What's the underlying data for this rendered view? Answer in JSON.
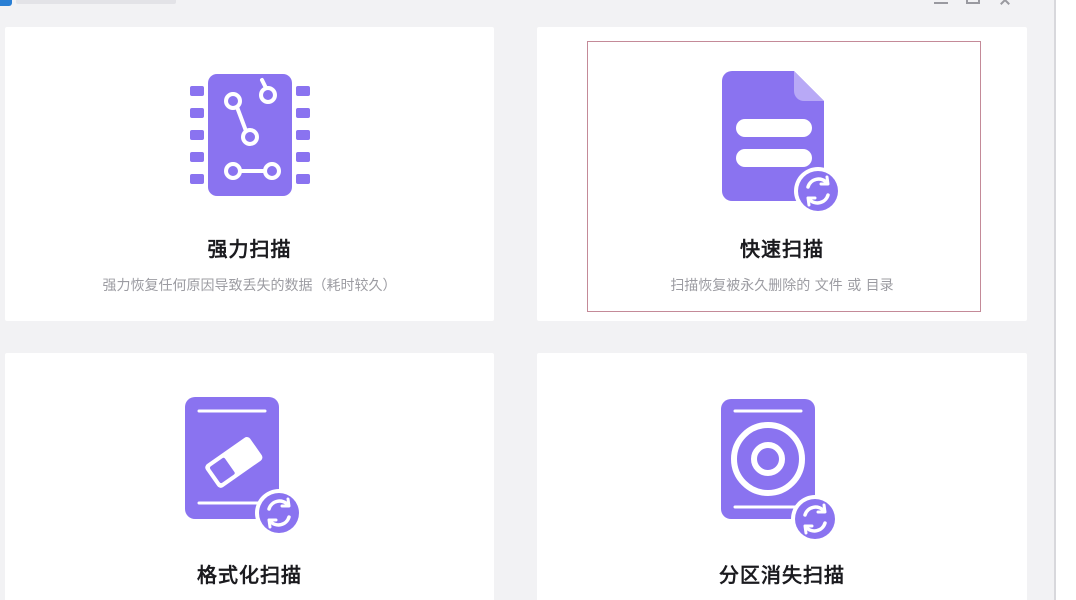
{
  "app": {
    "title": "",
    "accent_color": "#8a73f0",
    "window_controls": [
      "minimize",
      "maximize",
      "close"
    ]
  },
  "scan_modes": [
    {
      "title": "强力扫描",
      "description": "强力恢复任何原因导致丢失的数据（耗时较久）",
      "icon": "chip-icon"
    },
    {
      "title": "快速扫描",
      "description": "扫描恢复被永久删除的 文件 或 目录",
      "icon": "document-refresh-icon",
      "focused": true
    },
    {
      "title": "格式化扫描",
      "description": "",
      "icon": "eraser-drive-icon"
    },
    {
      "title": "分区消失扫描",
      "description": "",
      "icon": "disk-refresh-icon"
    }
  ]
}
